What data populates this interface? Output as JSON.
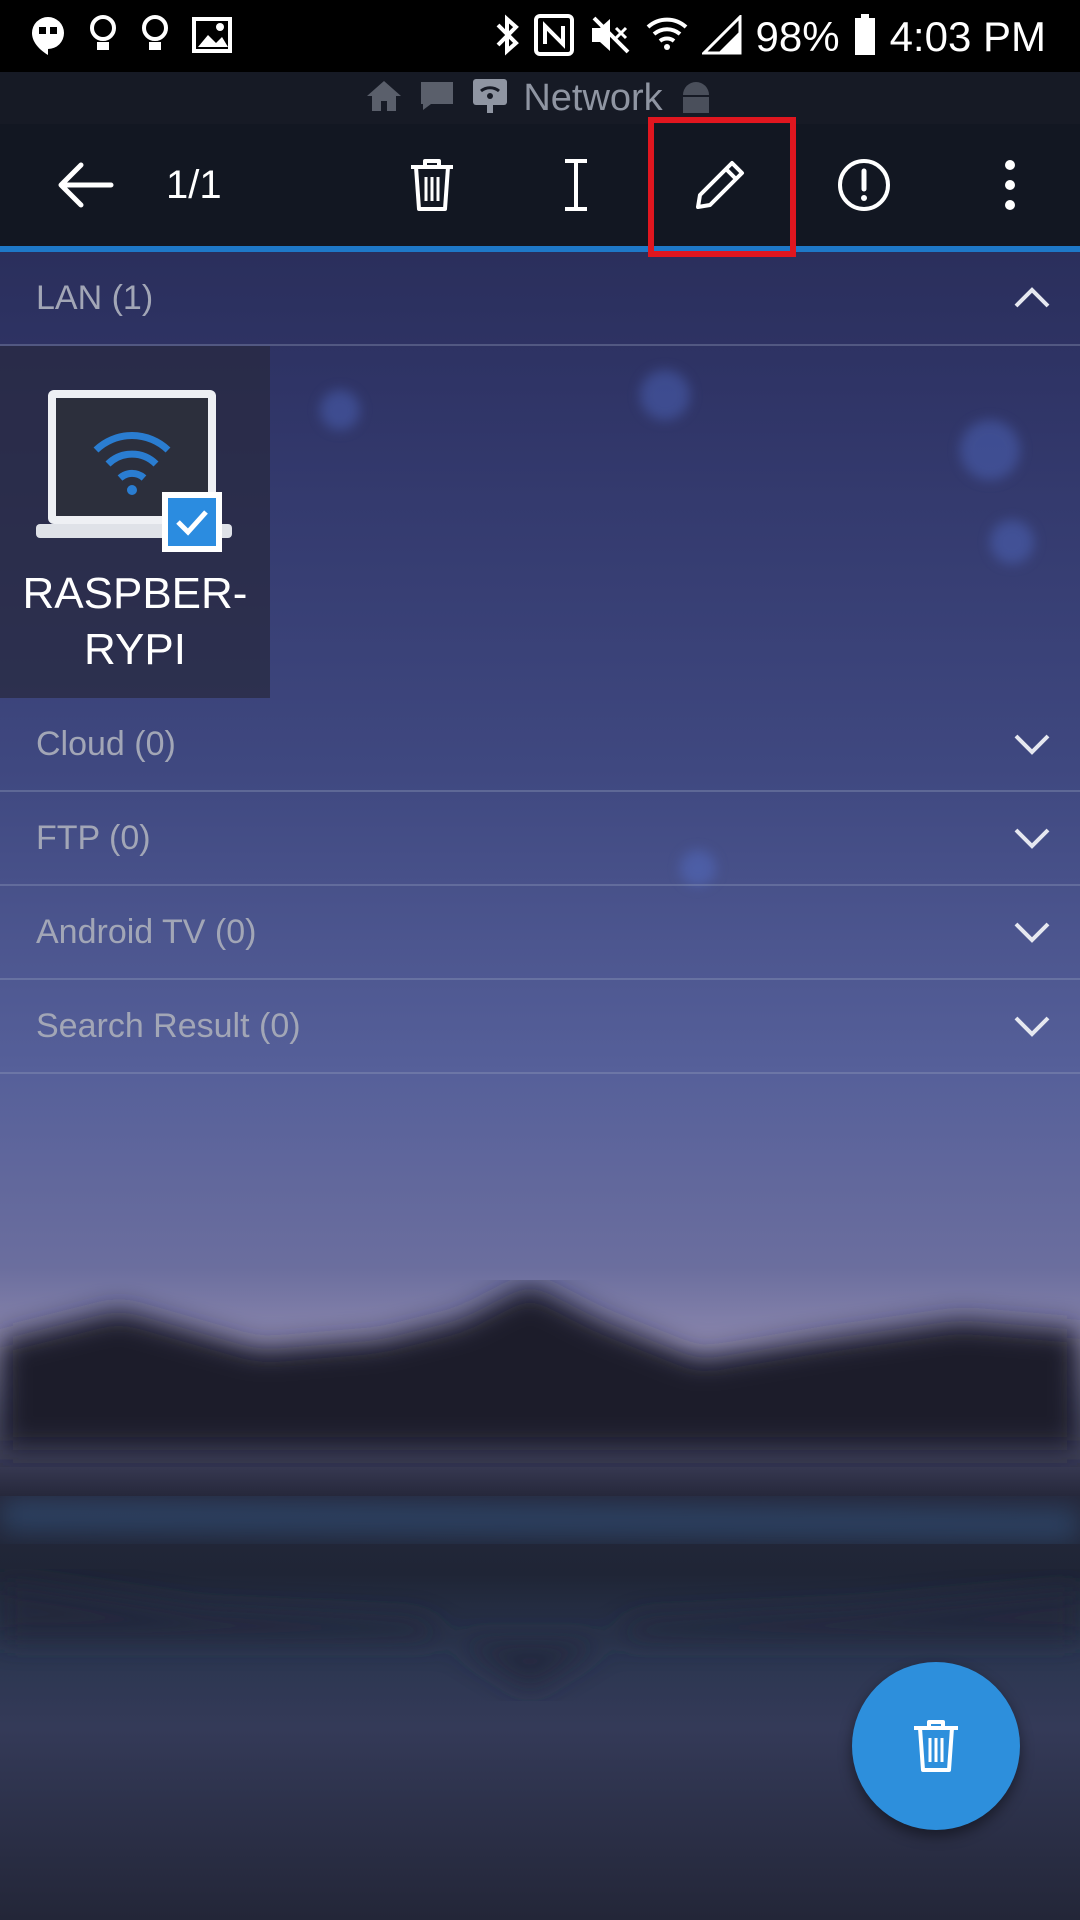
{
  "status_bar": {
    "battery": "98%",
    "time": "4:03 PM",
    "icons": [
      "hangouts-icon",
      "bulb-icon",
      "bulb-icon",
      "gallery-icon",
      "bluetooth-icon",
      "nfc-icon",
      "mute-icon",
      "wifi-icon",
      "signal-icon",
      "battery-icon"
    ]
  },
  "breadcrumb": {
    "label": "Network",
    "icons": [
      "home-icon",
      "sd-card-icon",
      "network-icon",
      "android-icon"
    ]
  },
  "toolbar": {
    "selection_count": "1/1",
    "actions": [
      "back-icon",
      "delete-icon",
      "rename-icon",
      "edit-icon",
      "info-icon",
      "more-icon"
    ],
    "highlighted_action": "edit-icon",
    "accent_color": "#1e78c8",
    "highlight_color": "#e0161f"
  },
  "sections": [
    {
      "title": "LAN (1)",
      "expanded": true
    },
    {
      "title": "Cloud (0)",
      "expanded": false
    },
    {
      "title": "FTP (0)",
      "expanded": false
    },
    {
      "title": "Android TV (0)",
      "expanded": false
    },
    {
      "title": "Search Result (0)",
      "expanded": false
    }
  ],
  "devices": [
    {
      "name_line1": "RASPBER-",
      "name_line2": "RYPI",
      "selected": true
    }
  ],
  "fab": {
    "icon": "trash-icon",
    "color": "#2d8fdc"
  }
}
